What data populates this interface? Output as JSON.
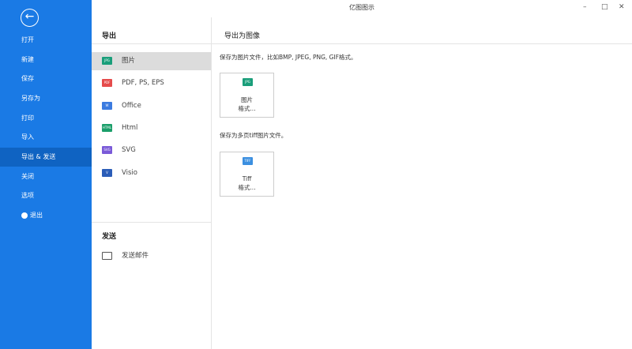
{
  "window": {
    "title": "亿图图示"
  },
  "sidebar": {
    "items": [
      "打开",
      "新建",
      "保存",
      "另存为",
      "打印",
      "导入",
      "导出 & 发送",
      "关闭",
      "选项",
      "退出"
    ],
    "active": "导出 & 发送"
  },
  "export": {
    "heading": "导出",
    "items": [
      {
        "label": "图片",
        "icon": "JPG",
        "color": "#1a9e7a"
      },
      {
        "label": "PDF, PS, EPS",
        "icon": "PDF",
        "color": "#e54b4b"
      },
      {
        "label": "Office",
        "icon": "W",
        "color": "#3b7be0"
      },
      {
        "label": "Html",
        "icon": "HTML",
        "color": "#1a9e6a"
      },
      {
        "label": "SVG",
        "icon": "SVG",
        "color": "#7a5ad8"
      },
      {
        "label": "Visio",
        "icon": "V",
        "color": "#2b5db8"
      }
    ]
  },
  "send": {
    "heading": "发送",
    "email": "发送邮件"
  },
  "panel": {
    "heading": "导出为图像",
    "desc1": "保存为图片文件，比如BMP, JPEG, PNG, GIF格式。",
    "card1_line1": "图片",
    "card1_line2": "格式...",
    "desc2": "保存为多页tiff图片文件。",
    "card2_line1": "Tiff",
    "card2_line2": "格式..."
  }
}
